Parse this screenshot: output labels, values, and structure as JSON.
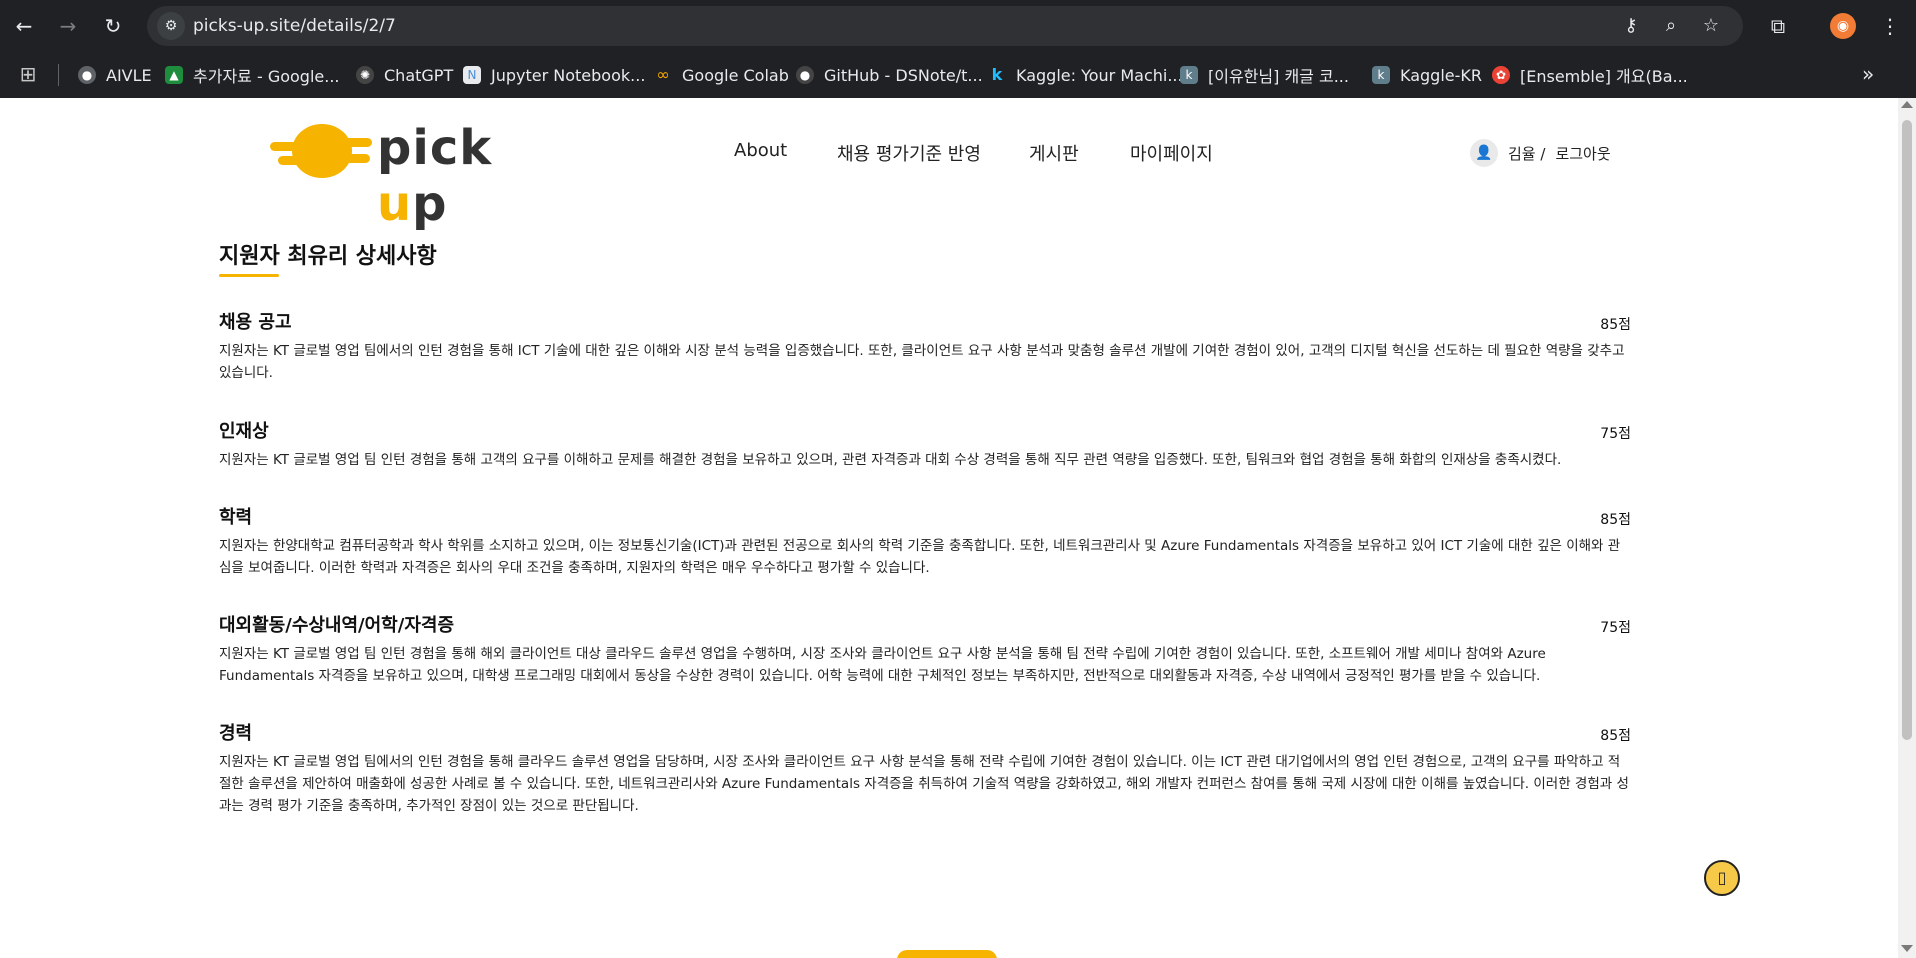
{
  "browser": {
    "url": "picks-up.site/details/2/7",
    "bookmarks": [
      {
        "label": "AIVLE",
        "icon": "globe-icon",
        "color": "#8ab4f8"
      },
      {
        "label": "추가자료 - Google...",
        "icon": "google-drive-icon",
        "color": "#fbbc04"
      },
      {
        "label": "ChatGPT",
        "icon": "chatgpt-icon",
        "color": "#e8eaed"
      },
      {
        "label": "Jupyter Notebook...",
        "icon": "jupyter-notebook-icon",
        "color": "#4a90d9"
      },
      {
        "label": "Google Colab",
        "icon": "colab-icon",
        "color": "#f9ab00"
      },
      {
        "label": "GitHub - DSNote/t...",
        "icon": "github-icon",
        "color": "#e8eaed"
      },
      {
        "label": "Kaggle: Your Machi...",
        "icon": "kaggle-icon",
        "color": "#20beff"
      },
      {
        "label": "[이유한님] 캐글 코...",
        "icon": "kaggle-k-icon",
        "color": "#607d8b"
      },
      {
        "label": "Kaggle-KR",
        "icon": "kaggle-k-icon",
        "color": "#607d8b"
      },
      {
        "label": "[Ensemble] 개요(Ba...",
        "icon": "ensemble-icon",
        "color": "#ea4335"
      }
    ]
  },
  "site": {
    "logo_text_1": "pick ",
    "logo_text_2": "u",
    "logo_text_3": "p",
    "brand_color": "#f6b400",
    "nav": [
      "About",
      "채용 평가기준 반영",
      "게시판",
      "마이페이지"
    ],
    "user_name": "김율 /",
    "logout": "로그아웃"
  },
  "page": {
    "title": "지원자 최유리 상세사항",
    "sections": [
      {
        "title": "채용 공고",
        "score": "85점",
        "body": "지원자는 KT 글로벌 영업 팀에서의 인턴 경험을 통해 ICT 기술에 대한 깊은 이해와 시장 분석 능력을 입증했습니다. 또한, 클라이언트 요구 사항 분석과 맞춤형 솔루션 개발에 기여한 경험이 있어, 고객의 디지털 혁신을 선도하는 데 필요한 역량을 갖추고 있습니다."
      },
      {
        "title": "인재상",
        "score": "75점",
        "body": "지원자는 KT 글로벌 영업 팀 인턴 경험을 통해 고객의 요구를 이해하고 문제를 해결한 경험을 보유하고 있으며, 관련 자격증과 대회 수상 경력을 통해 직무 관련 역량을 입증했다. 또한, 팀워크와 협업 경험을 통해 화합의 인재상을 충족시켰다."
      },
      {
        "title": "학력",
        "score": "85점",
        "body": "지원자는 한양대학교 컴퓨터공학과 학사 학위를 소지하고 있으며, 이는 정보통신기술(ICT)과 관련된 전공으로 회사의 학력 기준을 충족합니다. 또한, 네트워크관리사 및 Azure Fundamentals 자격증을 보유하고 있어 ICT 기술에 대한 깊은 이해와 관심을 보여줍니다. 이러한 학력과 자격증은 회사의 우대 조건을 충족하며, 지원자의 학력은 매우 우수하다고 평가할 수 있습니다."
      },
      {
        "title": "대외활동/수상내역/어학/자격증",
        "score": "75점",
        "body": "지원자는 KT 글로벌 영업 팀 인턴 경험을 통해 해외 클라이언트 대상 클라우드 솔루션 영업을 수행하며, 시장 조사와 클라이언트 요구 사항 분석을 통해 팀 전략 수립에 기여한 경험이 있습니다. 또한, 소프트웨어 개발 세미나 참여와 Azure Fundamentals 자격증을 보유하고 있으며, 대학생 프로그래밍 대회에서 동상을 수상한 경력이 있습니다. 어학 능력에 대한 구체적인 정보는 부족하지만, 전반적으로 대외활동과 자격증, 수상 내역에서 긍정적인 평가를 받을 수 있습니다."
      },
      {
        "title": "경력",
        "score": "85점",
        "body": "지원자는 KT 글로벌 영업 팀에서의 인턴 경험을 통해 클라우드 솔루션 영업을 담당하며, 시장 조사와 클라이언트 요구 사항 분석을 통해 전략 수립에 기여한 경험이 있습니다. 이는 ICT 관련 대기업에서의 영업 인턴 경험으로, 고객의 요구를 파악하고 적절한 솔루션을 제안하여 매출화에 성공한 사례로 볼 수 있습니다. 또한, 네트워크관리사와 Azure Fundamentals 자격증을 취득하여 기술적 역량을 강화하였고, 해외 개발자 컨퍼런스 참여를 통해 국제 시장에 대한 이해를 높였습니다. 이러한 경험과 성과는 경력 평가 기준을 충족하며, 추가적인 장점이 있는 것으로 판단됩니다."
      }
    ]
  }
}
